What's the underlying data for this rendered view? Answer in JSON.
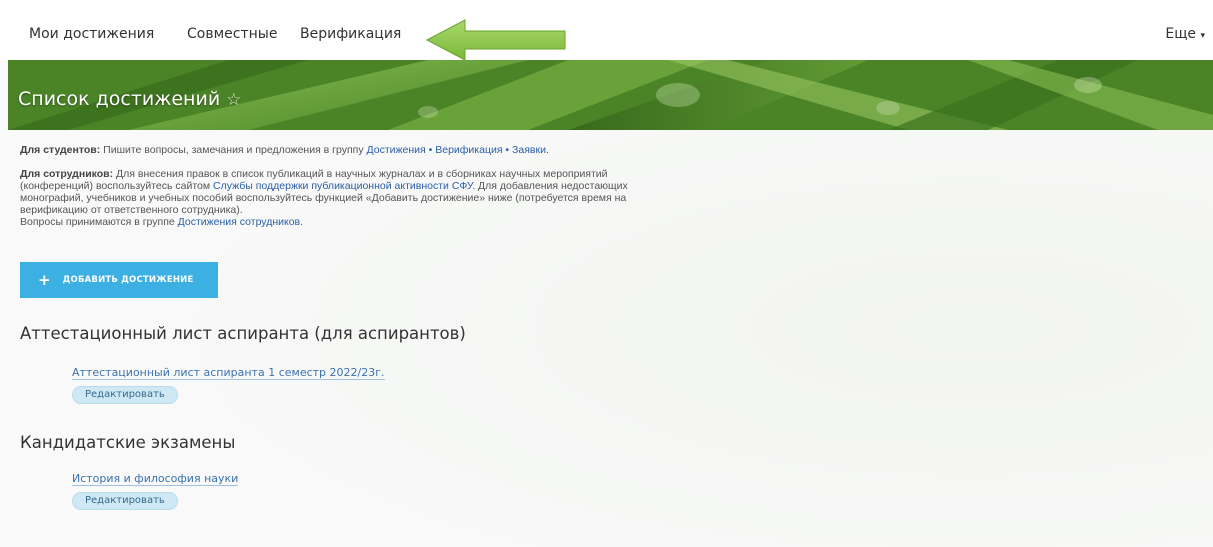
{
  "nav": {
    "items": [
      "Мои достижения",
      "Совместные",
      "Верификация"
    ],
    "more": "Еще",
    "more_caret": "▾"
  },
  "banner": {
    "title": "Список достижений"
  },
  "info": {
    "students_label": "Для студентов:",
    "students_text": " Пишите вопросы, замечания и предложения в группу ",
    "students_link": "Достижения • Верификация • Заявки",
    "students_end": ".",
    "staff_label": "Для сотрудников:",
    "staff_text1": " Для внесения правок в список публикаций в научных журналах и в сборниках научных мероприятий (конференций) воспользуйтесь сайтом ",
    "staff_link1": "Службы поддержки публикационной активности СФУ",
    "staff_text2": ". Для добавления недостающих монографий, учебников и учебных пособий воспользуйтесь функцией «Добавить достижение» ниже (потребуется время на верификацию от ответственного сотрудника).",
    "staff_text3": "Вопросы принимаются в группе ",
    "staff_link2": "Достижения сотрудников",
    "staff_end": "."
  },
  "add_button": {
    "icon": "+",
    "label": "ДОБАВИТЬ ДОСТИЖЕНИЕ"
  },
  "sections": [
    {
      "title": "Аттестационный лист аспиранта (для аспирантов)",
      "item": "Аттестационный лист аспиранта 1 семестр 2022/23г.",
      "edit": "Редактировать"
    },
    {
      "title": "Кандидатские экзамены",
      "item": "История и философия науки",
      "edit": "Редактировать"
    }
  ],
  "colors": {
    "accent": "#3cb0e3",
    "link": "#2a5fa8",
    "arrow": "#8cc63f"
  }
}
